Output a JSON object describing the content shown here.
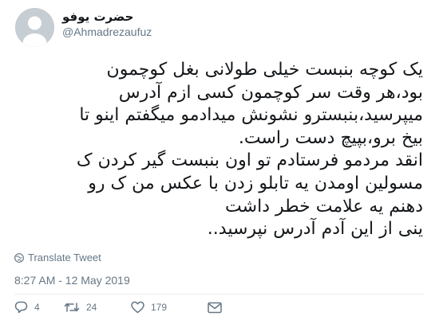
{
  "user": {
    "display_name": "حضرت یوفو",
    "handle": "@Ahmadrezaufuz"
  },
  "tweet": {
    "lines": [
      "یک کوچه بنبست خیلی طولانی بغل کوچمون",
      "بود،هر وقت سر کوچمون کسی ازم آدرس",
      "میپرسید،بنبسترو نشونش میدادمو میگفتم اینو تا",
      "بیخ برو،بپیچ دست راست.",
      "انقد مردمو فرستادم تو اون بنبست گیر کردن ک",
      "مسولین اومدن یه تابلو زدن با عکس من ک رو",
      "دهنم یه علامت خطر داشت",
      "ینی از این آدم آدرس نپرسید.."
    ]
  },
  "translate_label": "Translate Tweet",
  "timestamp": "8:27 AM - 12 May 2019",
  "counts": {
    "replies": "4",
    "retweets": "24",
    "likes": "179"
  },
  "colors": {
    "text": "#14171a",
    "secondary": "#657786",
    "divider": "#e6ecf0",
    "avatar_bg": "#c6cdd3"
  },
  "icons": [
    "default-avatar-icon",
    "globe-icon",
    "reply-icon",
    "retweet-icon",
    "like-icon",
    "message-icon"
  ]
}
